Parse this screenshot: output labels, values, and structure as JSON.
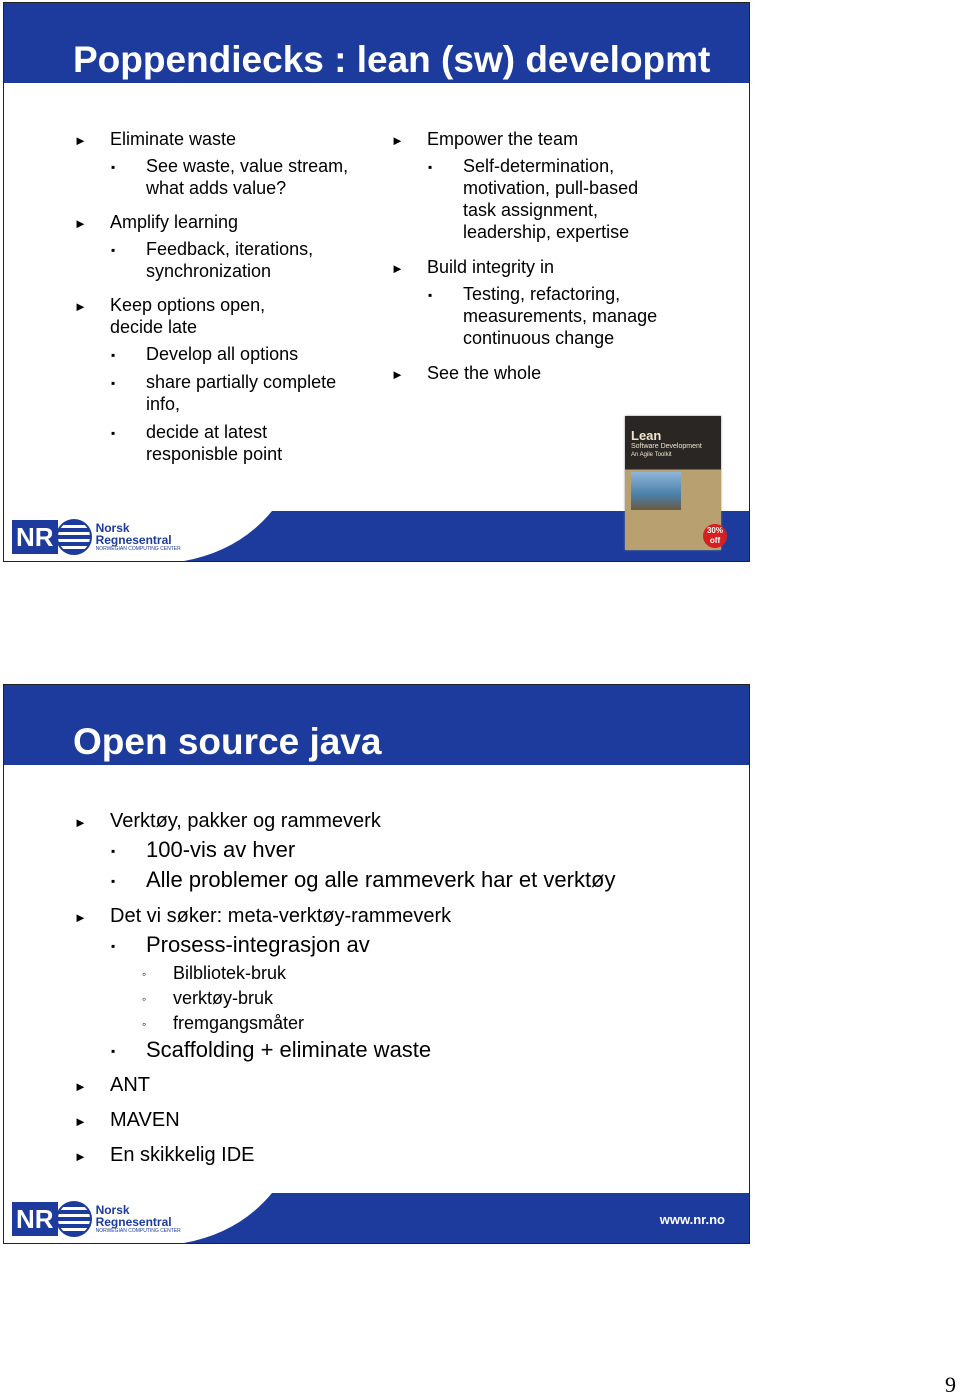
{
  "slide1": {
    "title": "Poppendiecks : lean (sw) developmt",
    "left": [
      {
        "lvl": 1,
        "text": "Eliminate waste"
      },
      {
        "lvl": 2,
        "text": "See waste, value stream,"
      },
      {
        "lvl": 0,
        "text": "what adds value?"
      },
      {
        "lvl": 1,
        "text": "Amplify learning"
      },
      {
        "lvl": 2,
        "text": "Feedback, iterations,"
      },
      {
        "lvl": 0,
        "text": "synchronization"
      },
      {
        "lvl": 1,
        "text": "Keep options open,"
      },
      {
        "lvl": -1,
        "text": "decide late"
      },
      {
        "lvl": 2,
        "text": "Develop all options"
      },
      {
        "lvl": 2,
        "text": "share partially complete"
      },
      {
        "lvl": 0,
        "text": "info,"
      },
      {
        "lvl": 2,
        "text": "decide at latest"
      },
      {
        "lvl": 0,
        "text": "responisble point"
      }
    ],
    "right": [
      {
        "lvl": 1,
        "text": "Empower the team"
      },
      {
        "lvl": 2,
        "text": "Self-determination,"
      },
      {
        "lvl": 0,
        "text": "motivation, pull-based"
      },
      {
        "lvl": 0,
        "text": "task assignment,"
      },
      {
        "lvl": 0,
        "text": "leadership, expertise"
      },
      {
        "lvl": 1,
        "text": "Build integrity in"
      },
      {
        "lvl": 2,
        "text": "Testing, refactoring,"
      },
      {
        "lvl": 0,
        "text": "measurements, manage"
      },
      {
        "lvl": 0,
        "text": "continuous change"
      },
      {
        "lvl": 1,
        "text": "See the whole"
      }
    ],
    "book": {
      "title": "Lean",
      "subtitle": "Software Development",
      "tagline": "An Agile Toolkit",
      "badge": "30% off"
    }
  },
  "slide2": {
    "title": "Open source java",
    "items": [
      {
        "lvl": 1,
        "text": "Verktøy, pakker og rammeverk"
      },
      {
        "lvl": 2,
        "text": "100-vis av hver"
      },
      {
        "lvl": 2,
        "text": "Alle problemer og alle rammeverk har et verktøy"
      },
      {
        "lvl": 1,
        "text": "Det vi søker: meta-verktøy-rammeverk"
      },
      {
        "lvl": 2,
        "text": "Prosess-integrasjon av"
      },
      {
        "lvl": 3,
        "text": "Bilbliotek-bruk"
      },
      {
        "lvl": 3,
        "text": "verktøy-bruk"
      },
      {
        "lvl": 3,
        "text": "fremgangsmåter"
      },
      {
        "lvl": 2,
        "text": "Scaffolding + eliminate waste"
      },
      {
        "lvl": 1,
        "text": "ANT"
      },
      {
        "lvl": 1,
        "text": "MAVEN"
      },
      {
        "lvl": 1,
        "text": "En skikkelig IDE"
      }
    ],
    "url": "www.nr.no"
  },
  "logo": {
    "mark": "NR",
    "name1": "Norsk",
    "name2": "Regnesentral",
    "tagline": "NORWEGIAN COMPUTING CENTER"
  },
  "page_number": "9",
  "colors": {
    "brand_blue": "#1c3b9c"
  }
}
